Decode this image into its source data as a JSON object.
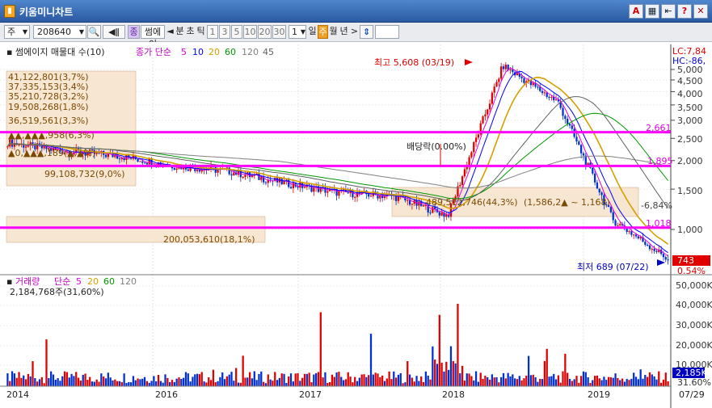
{
  "window": {
    "title": "키움미니차트",
    "icon": "chart-app-icon"
  },
  "title_buttons": [
    "A",
    "▦",
    "⇤",
    "?",
    "✕"
  ],
  "toolbar": {
    "market": "주",
    "code": "208640",
    "stock_name": "썸에이",
    "tabs": [
      "분",
      "초",
      "틱"
    ],
    "intervals": [
      "1",
      "3",
      "5",
      "10",
      "20",
      "30"
    ],
    "count": "1",
    "periods": [
      "일",
      "주",
      "월",
      "년"
    ],
    "active_period": "주",
    "arrow_left": "◄",
    "arrow_right": ">"
  },
  "price_panel": {
    "legend_name": "썸에이지 매물대 수(10)",
    "legend_ma": "종가 단순",
    "ma_periods": [
      "5",
      "10",
      "20",
      "60",
      "120",
      "45"
    ],
    "ma_colors": [
      "#e000e0",
      "#0000ff",
      "#d4a000",
      "#009900",
      "#808080",
      "#606060"
    ],
    "lc": "LC:7,84",
    "hc": "HC:-86,",
    "y_ticks": [
      "5,000",
      "4,500",
      "4,000",
      "3,500",
      "3,000",
      "2,500",
      "2,000",
      "1,500",
      "1,000"
    ],
    "hlines": [
      "2,661",
      "1,895",
      "1,018"
    ],
    "max_label": "최고 5,608 (03/19)",
    "min_label": "최저 689 (07/22)",
    "dividend_label": "배당락(0.00%)",
    "current_price": "743",
    "current_change": "0.54%",
    "pct_label": "-6,84%",
    "volume_profile": [
      "41,122,801(3,7%)",
      "37,335,153(3,4%)",
      "35,210,728(3,2%)",
      "19,508,268(1,8%)",
      "36,519,561(3,3%)",
      "▲▲,▲▲▲,958(6,3%)",
      "▲0,▲▲▲,189(▲,▲%)",
      "99,108,732(9,0%)",
      "200,053,610(18,1%)",
      "489,512,746(44,3%)",
      "(1,586,2▲ ~ 1,168)"
    ]
  },
  "volume_panel": {
    "legend_name": "거래량",
    "legend_ma": "단순",
    "ma_periods": [
      "5",
      "20",
      "60",
      "120"
    ],
    "ma_colors": [
      "#e000e0",
      "#d4a000",
      "#009900",
      "#808080"
    ],
    "volume_text": "2,184,768주(31,60%)",
    "y_ticks": [
      "50,000K",
      "40,000K",
      "30,000K",
      "20,000K",
      "10,000K"
    ],
    "current": "2,185K",
    "current_pct": "31.60%"
  },
  "x_axis": [
    "2014",
    "2016",
    "2017",
    "2018",
    "2019",
    "07/29"
  ],
  "chart_data": {
    "type": "candlestick",
    "x": [
      "2014-01",
      "2014-07",
      "2015-01",
      "2015-07",
      "2016-01",
      "2016-07",
      "2017-01",
      "2017-07",
      "2018-01",
      "2018-03",
      "2018-07",
      "2019-01",
      "2019-07"
    ],
    "close": [
      2400,
      2200,
      2100,
      1900,
      1800,
      1600,
      1450,
      1400,
      1150,
      5200,
      3600,
      1100,
      743
    ],
    "max": {
      "value": 5608,
      "date": "03/19"
    },
    "min": {
      "value": 689,
      "date": "07/22"
    }
  }
}
